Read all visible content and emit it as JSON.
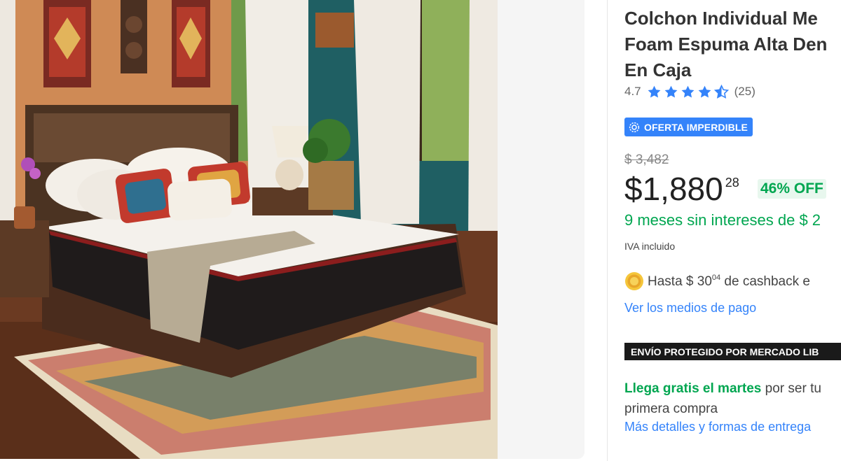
{
  "product": {
    "title_lines": [
      "Colchon Individual Me",
      "Foam Espuma Alta Den",
      "En Caja"
    ],
    "rating": {
      "value": "4.7",
      "count": "(25)",
      "stars": 4.5
    },
    "badge": {
      "icon": "gear-badge-icon",
      "label": "OFERTA IMPERDIBLE"
    },
    "price": {
      "original": "$ 3,482",
      "current": "$1,880",
      "cents": "28",
      "discount": "46% OFF"
    },
    "installments": "9 meses sin intereses de $ 2",
    "tax_note": "IVA incluido",
    "cashback": {
      "prefix": "Hasta $ 30",
      "cents": "04",
      "suffix": " de cashback e"
    },
    "payment_link": "Ver los medios de pago",
    "shipping_banner": "ENVÍO PROTEGIDO POR MERCADO LIB",
    "delivery": {
      "highlight": "Llega gratis el martes",
      "rest_line1": " por ser tu",
      "line2": "primera compra",
      "link": "Más detalles y formas de entrega"
    }
  },
  "colors": {
    "accent_blue": "#3483fa",
    "green": "#00a650",
    "banner_dark": "#1a1a1a",
    "text": "#333333"
  }
}
